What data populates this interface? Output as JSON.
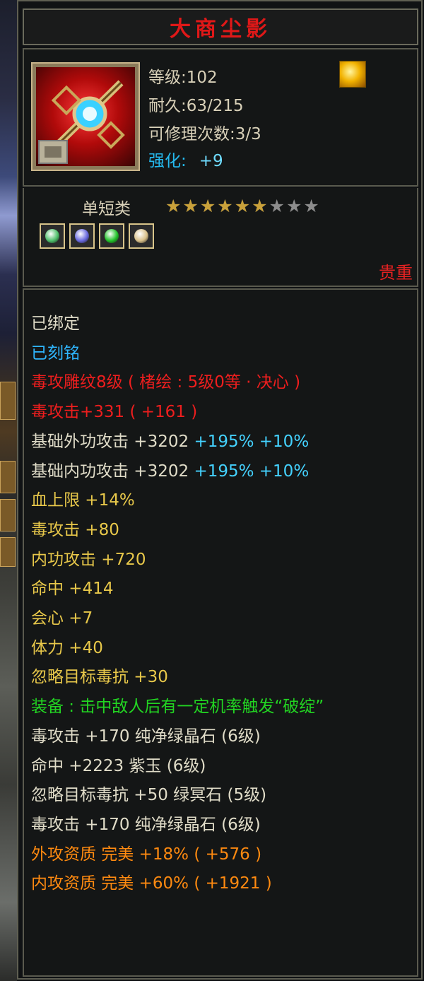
{
  "title": "大商尘影",
  "item": {
    "level": "等级:102",
    "durability": "耐久:63/215",
    "repair": "可修理次数:3/3",
    "enhance_label": "强化:",
    "enhance_value": "+9",
    "category": "单短类",
    "stars_on": 6,
    "stars_total": 9,
    "rarity": "贵重",
    "gem_colors": [
      "#4fbf6a",
      "#6a6ae0",
      "#22c22a",
      "#d9c089"
    ]
  },
  "lines": {
    "bound": "已绑定",
    "engraved": "已刻铭",
    "carving": "毒攻雕纹8级 ( 楮绘 : 5级0等 · 决心 )",
    "poison_attack_main": "毒攻击+331 ( +161 )",
    "ext_attack_label": "基础外功攻击 +3202",
    "ext_attack_pct": "+195% +10%",
    "int_attack_label": "基础内功攻击 +3202",
    "int_attack_pct": "+195% +10%",
    "hp": "血上限 +14%",
    "poison_attack": "毒攻击 +80",
    "inner_attack": "内功攻击 +720",
    "hit": "命中 +414",
    "crit": "会心 +7",
    "stamina": "体力 +40",
    "ignore_resist": "忽略目标毒抗 +30",
    "equip_effect": "装备 : 击中敌人后有一定机率触发“破绽”",
    "gem1": "毒攻击 +170 纯净绿晶石 (6级)",
    "gem2": "命中 +2223 紫玉 (6级)",
    "gem3": "忽略目标毒抗 +50 绿冥石 (5级)",
    "gem4": "毒攻击 +170 纯净绿晶石 (6级)",
    "ext_quality": "外攻资质  完美 +18% ( +576 )",
    "int_quality": "内攻资质  完美 +60% ( +1921 )"
  }
}
